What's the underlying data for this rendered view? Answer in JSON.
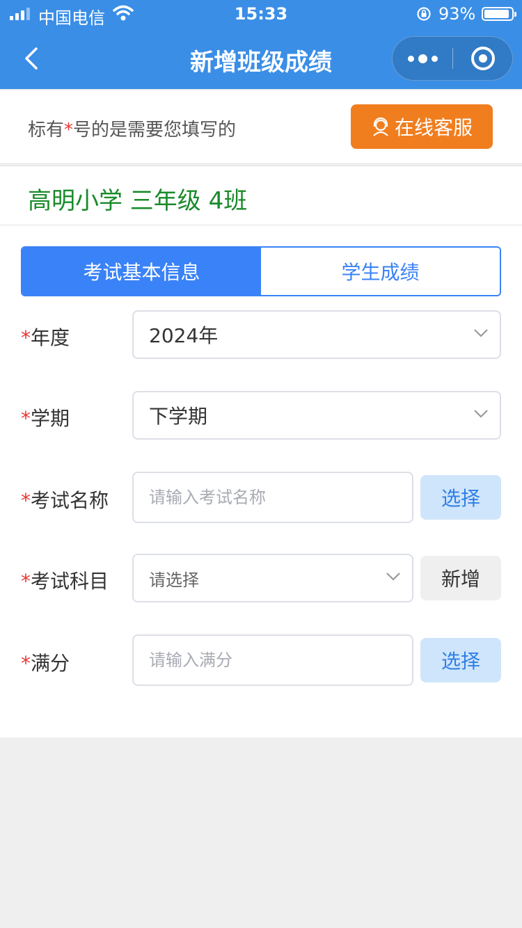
{
  "status_bar": {
    "carrier": "中国电信",
    "time": "15:33",
    "battery_percent": "93%",
    "battery_level": 0.93,
    "icons": [
      "signal-icon",
      "wifi-icon",
      "orientation-lock-icon",
      "battery-icon"
    ]
  },
  "nav": {
    "title": "新增班级成绩",
    "icons": [
      "back-arrow-icon",
      "more-dots-icon",
      "close-circle-icon"
    ]
  },
  "notice": {
    "prefix": "标有",
    "star": "*",
    "suffix": "号的是需要您填写的",
    "service_button": "在线客服",
    "service_icon": "headset-icon"
  },
  "school": {
    "name": "高明小学 三年级 4班"
  },
  "tabs": [
    {
      "label": "考试基本信息",
      "active": true
    },
    {
      "label": "学生成绩",
      "active": false
    }
  ],
  "form": {
    "year": {
      "star": "*",
      "label": "年度",
      "value": "2024年"
    },
    "term": {
      "star": "*",
      "label": "学期",
      "value": "下学期"
    },
    "exam_name": {
      "star": "*",
      "label": "考试名称",
      "placeholder": "请输入考试名称",
      "button": "选择"
    },
    "subject": {
      "star": "*",
      "label": "考试科目",
      "placeholder": "请选择",
      "button": "新增"
    },
    "full_score": {
      "star": "*",
      "label": "满分",
      "placeholder": "请输入满分",
      "button": "选择"
    }
  },
  "colors": {
    "header": "#3a8ee6",
    "primary": "#3a82f7",
    "service": "#f07e1f",
    "school_text": "#1a8a2a",
    "required_star": "#e53935"
  }
}
